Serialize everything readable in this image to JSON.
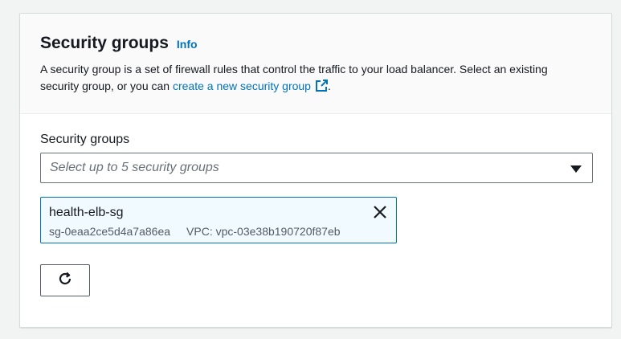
{
  "section": {
    "title": "Security groups",
    "info_label": "Info",
    "description_before": "A security group is a set of firewall rules that control the traffic to your load balancer. Select an existing security group, or you can ",
    "description_link": "create a new security group",
    "description_after": "."
  },
  "field": {
    "label": "Security groups",
    "placeholder": "Select up to 5 security groups"
  },
  "selected_group": {
    "name": "health-elb-sg",
    "id": "sg-0eaa2ce5d4a7a86ea",
    "vpc": "VPC: vpc-03e38b190720f87eb"
  },
  "icons": {
    "external": "external-link-icon",
    "caret": "caret-down-icon",
    "remove": "close-icon",
    "refresh": "refresh-icon"
  },
  "colors": {
    "link": "#0073bb",
    "text": "#16191f",
    "token_bg": "#f1faff",
    "token_border": "#0073bb"
  }
}
